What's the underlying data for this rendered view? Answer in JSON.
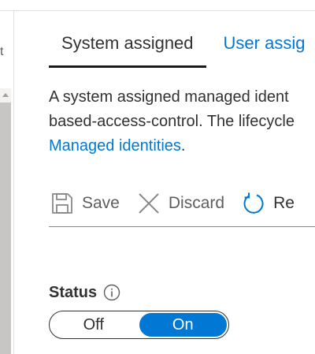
{
  "tabs": [
    {
      "label": "System assigned",
      "active": true
    },
    {
      "label": "User assig",
      "active": false
    }
  ],
  "description": {
    "line1": "A system assigned managed ident",
    "line2": "based-access-control. The lifecycle",
    "link": "Managed identities",
    "link_suffix": "."
  },
  "toolbar": {
    "save_label": "Save",
    "discard_label": "Discard",
    "refresh_label": "Re"
  },
  "status": {
    "label": "Status",
    "off_label": "Off",
    "on_label": "On",
    "selected": "On"
  },
  "left_panel": {
    "glyph": "t"
  },
  "colors": {
    "accent": "#0078d4",
    "text": "#323130",
    "muted": "#605e5c",
    "divider": "#e1dfdd"
  },
  "icons": {
    "save": "floppy-disk-icon",
    "discard": "x-icon",
    "refresh": "refresh-icon",
    "info": "info-icon",
    "scroll_up": "chevron-up-icon"
  }
}
